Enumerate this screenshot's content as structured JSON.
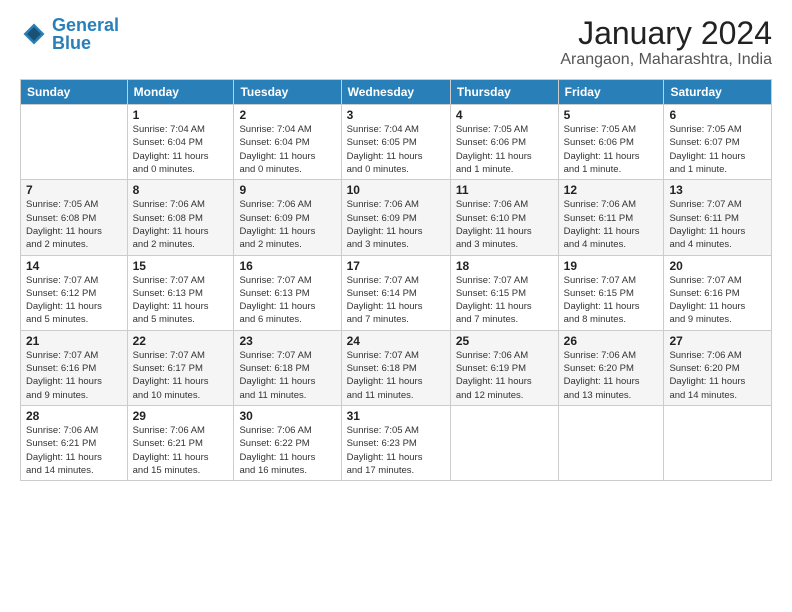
{
  "logo": {
    "text1": "General",
    "text2": "Blue"
  },
  "title": "January 2024",
  "subtitle": "Arangaon, Maharashtra, India",
  "weekdays": [
    "Sunday",
    "Monday",
    "Tuesday",
    "Wednesday",
    "Thursday",
    "Friday",
    "Saturday"
  ],
  "weeks": [
    [
      {
        "num": "",
        "info": ""
      },
      {
        "num": "1",
        "info": "Sunrise: 7:04 AM\nSunset: 6:04 PM\nDaylight: 11 hours\nand 0 minutes."
      },
      {
        "num": "2",
        "info": "Sunrise: 7:04 AM\nSunset: 6:04 PM\nDaylight: 11 hours\nand 0 minutes."
      },
      {
        "num": "3",
        "info": "Sunrise: 7:04 AM\nSunset: 6:05 PM\nDaylight: 11 hours\nand 0 minutes."
      },
      {
        "num": "4",
        "info": "Sunrise: 7:05 AM\nSunset: 6:06 PM\nDaylight: 11 hours\nand 1 minute."
      },
      {
        "num": "5",
        "info": "Sunrise: 7:05 AM\nSunset: 6:06 PM\nDaylight: 11 hours\nand 1 minute."
      },
      {
        "num": "6",
        "info": "Sunrise: 7:05 AM\nSunset: 6:07 PM\nDaylight: 11 hours\nand 1 minute."
      }
    ],
    [
      {
        "num": "7",
        "info": "Sunrise: 7:05 AM\nSunset: 6:08 PM\nDaylight: 11 hours\nand 2 minutes."
      },
      {
        "num": "8",
        "info": "Sunrise: 7:06 AM\nSunset: 6:08 PM\nDaylight: 11 hours\nand 2 minutes."
      },
      {
        "num": "9",
        "info": "Sunrise: 7:06 AM\nSunset: 6:09 PM\nDaylight: 11 hours\nand 2 minutes."
      },
      {
        "num": "10",
        "info": "Sunrise: 7:06 AM\nSunset: 6:09 PM\nDaylight: 11 hours\nand 3 minutes."
      },
      {
        "num": "11",
        "info": "Sunrise: 7:06 AM\nSunset: 6:10 PM\nDaylight: 11 hours\nand 3 minutes."
      },
      {
        "num": "12",
        "info": "Sunrise: 7:06 AM\nSunset: 6:11 PM\nDaylight: 11 hours\nand 4 minutes."
      },
      {
        "num": "13",
        "info": "Sunrise: 7:07 AM\nSunset: 6:11 PM\nDaylight: 11 hours\nand 4 minutes."
      }
    ],
    [
      {
        "num": "14",
        "info": "Sunrise: 7:07 AM\nSunset: 6:12 PM\nDaylight: 11 hours\nand 5 minutes."
      },
      {
        "num": "15",
        "info": "Sunrise: 7:07 AM\nSunset: 6:13 PM\nDaylight: 11 hours\nand 5 minutes."
      },
      {
        "num": "16",
        "info": "Sunrise: 7:07 AM\nSunset: 6:13 PM\nDaylight: 11 hours\nand 6 minutes."
      },
      {
        "num": "17",
        "info": "Sunrise: 7:07 AM\nSunset: 6:14 PM\nDaylight: 11 hours\nand 7 minutes."
      },
      {
        "num": "18",
        "info": "Sunrise: 7:07 AM\nSunset: 6:15 PM\nDaylight: 11 hours\nand 7 minutes."
      },
      {
        "num": "19",
        "info": "Sunrise: 7:07 AM\nSunset: 6:15 PM\nDaylight: 11 hours\nand 8 minutes."
      },
      {
        "num": "20",
        "info": "Sunrise: 7:07 AM\nSunset: 6:16 PM\nDaylight: 11 hours\nand 9 minutes."
      }
    ],
    [
      {
        "num": "21",
        "info": "Sunrise: 7:07 AM\nSunset: 6:16 PM\nDaylight: 11 hours\nand 9 minutes."
      },
      {
        "num": "22",
        "info": "Sunrise: 7:07 AM\nSunset: 6:17 PM\nDaylight: 11 hours\nand 10 minutes."
      },
      {
        "num": "23",
        "info": "Sunrise: 7:07 AM\nSunset: 6:18 PM\nDaylight: 11 hours\nand 11 minutes."
      },
      {
        "num": "24",
        "info": "Sunrise: 7:07 AM\nSunset: 6:18 PM\nDaylight: 11 hours\nand 11 minutes."
      },
      {
        "num": "25",
        "info": "Sunrise: 7:06 AM\nSunset: 6:19 PM\nDaylight: 11 hours\nand 12 minutes."
      },
      {
        "num": "26",
        "info": "Sunrise: 7:06 AM\nSunset: 6:20 PM\nDaylight: 11 hours\nand 13 minutes."
      },
      {
        "num": "27",
        "info": "Sunrise: 7:06 AM\nSunset: 6:20 PM\nDaylight: 11 hours\nand 14 minutes."
      }
    ],
    [
      {
        "num": "28",
        "info": "Sunrise: 7:06 AM\nSunset: 6:21 PM\nDaylight: 11 hours\nand 14 minutes."
      },
      {
        "num": "29",
        "info": "Sunrise: 7:06 AM\nSunset: 6:21 PM\nDaylight: 11 hours\nand 15 minutes."
      },
      {
        "num": "30",
        "info": "Sunrise: 7:06 AM\nSunset: 6:22 PM\nDaylight: 11 hours\nand 16 minutes."
      },
      {
        "num": "31",
        "info": "Sunrise: 7:05 AM\nSunset: 6:23 PM\nDaylight: 11 hours\nand 17 minutes."
      },
      {
        "num": "",
        "info": ""
      },
      {
        "num": "",
        "info": ""
      },
      {
        "num": "",
        "info": ""
      }
    ]
  ]
}
